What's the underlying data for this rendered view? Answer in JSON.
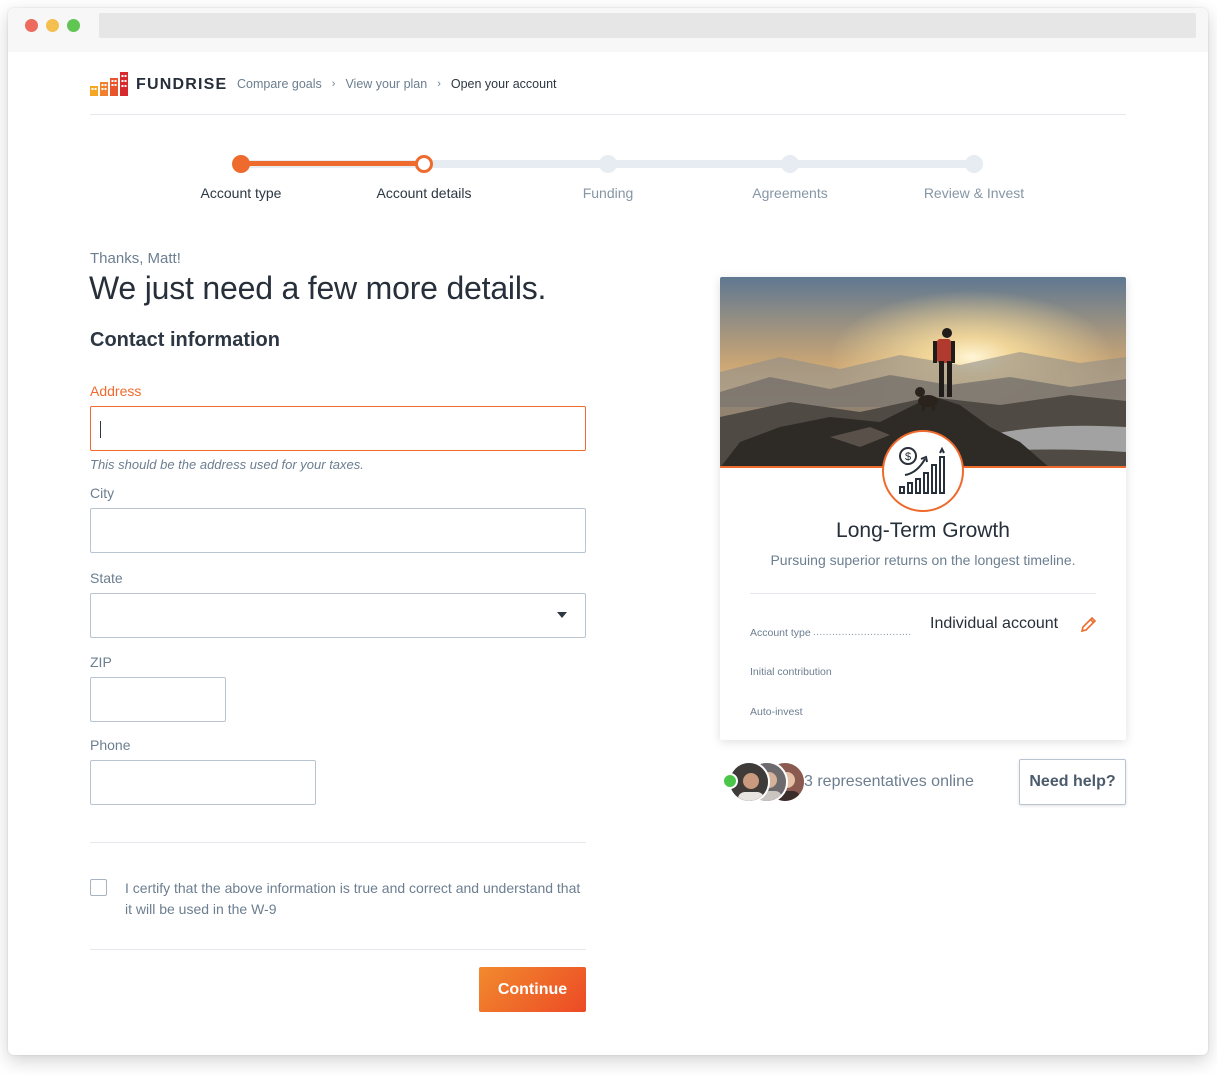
{
  "brand": {
    "name": "FUNDRISE",
    "accent": "#ee6a2d"
  },
  "breadcrumb": [
    {
      "label": "Compare goals"
    },
    {
      "label": "View your plan"
    },
    {
      "label": "Open your account"
    }
  ],
  "steps": [
    {
      "label": "Account type",
      "state": "done"
    },
    {
      "label": "Account details",
      "state": "current"
    },
    {
      "label": "Funding",
      "state": "upcoming"
    },
    {
      "label": "Agreements",
      "state": "upcoming"
    },
    {
      "label": "Review & Invest",
      "state": "upcoming"
    }
  ],
  "form": {
    "greeting": "Thanks, Matt!",
    "headline": "We just need a few more details.",
    "section_title": "Contact information",
    "address": {
      "label": "Address",
      "value": "",
      "hint": "This should be the address used for your taxes."
    },
    "city": {
      "label": "City",
      "value": ""
    },
    "state": {
      "label": "State",
      "value": ""
    },
    "zip": {
      "label": "ZIP",
      "value": ""
    },
    "phone": {
      "label": "Phone",
      "value": ""
    },
    "certify": "I certify that the above information is true and correct and understand that it will be used in the W-9",
    "continue_label": "Continue"
  },
  "plan_card": {
    "icon": "dollar-growth-chart-icon",
    "title": "Long-Term Growth",
    "subtitle": "Pursuing superior returns on the longest timeline.",
    "account_type_label": "Account type",
    "account_type_value": "Individual account",
    "initial_contribution_label": "Initial contribution",
    "auto_invest_label": "Auto-invest"
  },
  "support": {
    "reps_text": "3 representatives online",
    "help_label": "Need help?"
  }
}
